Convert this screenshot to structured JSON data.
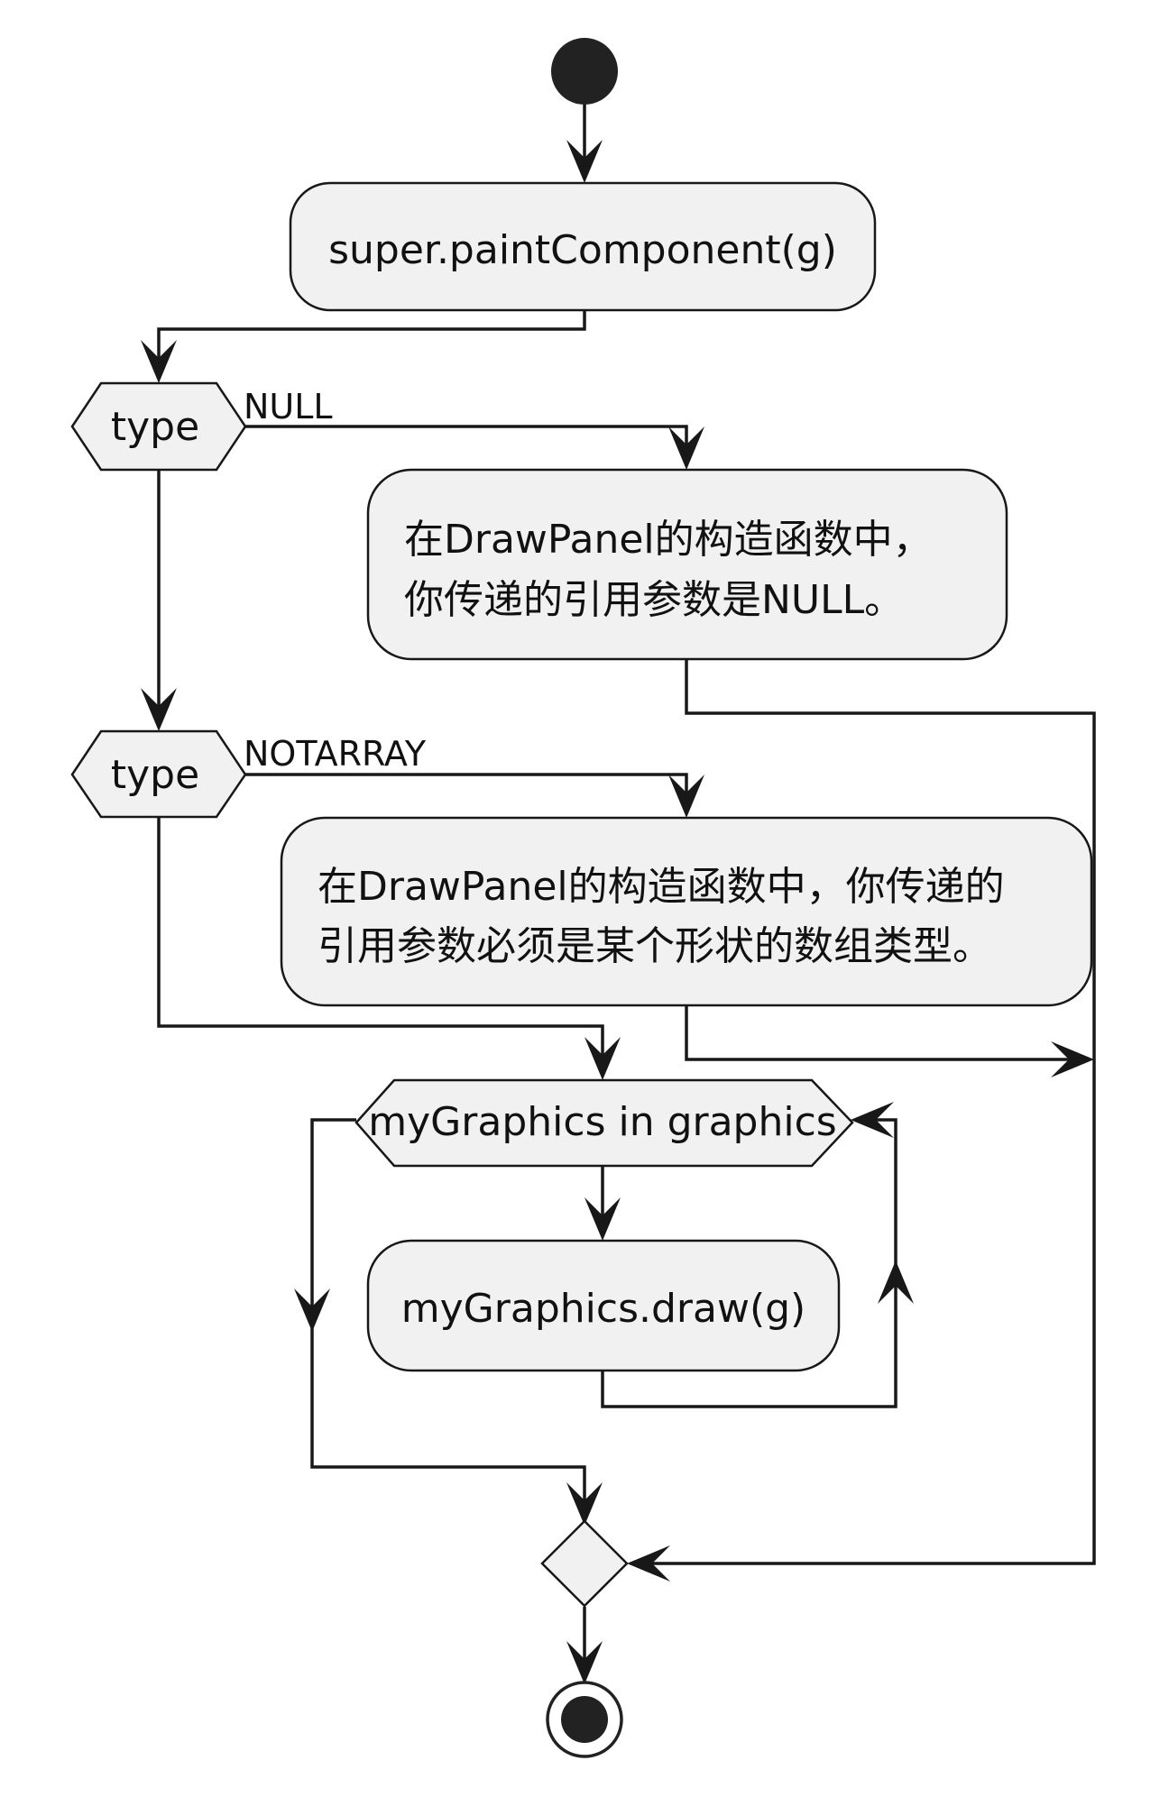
{
  "actions": {
    "super_paint": "super.paintComponent(g)",
    "null_msg_line1": "在DrawPanel的构造函数中，",
    "null_msg_line2": "你传递的引用参数是NULL。",
    "notarray_msg_line1": "在DrawPanel的构造函数中，你传递的",
    "notarray_msg_line2": "引用参数必须是某个形状的数组类型。",
    "draw_call": "myGraphics.draw(g)"
  },
  "decisions": {
    "type_1": "type",
    "type_2": "type",
    "loop": "myGraphics in graphics"
  },
  "guards": {
    "null": "NULL",
    "notarray": "NOTARRAY"
  },
  "colors": {
    "node_fill": "#f1f1f1",
    "line": "#181818",
    "start_end": "#222222"
  }
}
